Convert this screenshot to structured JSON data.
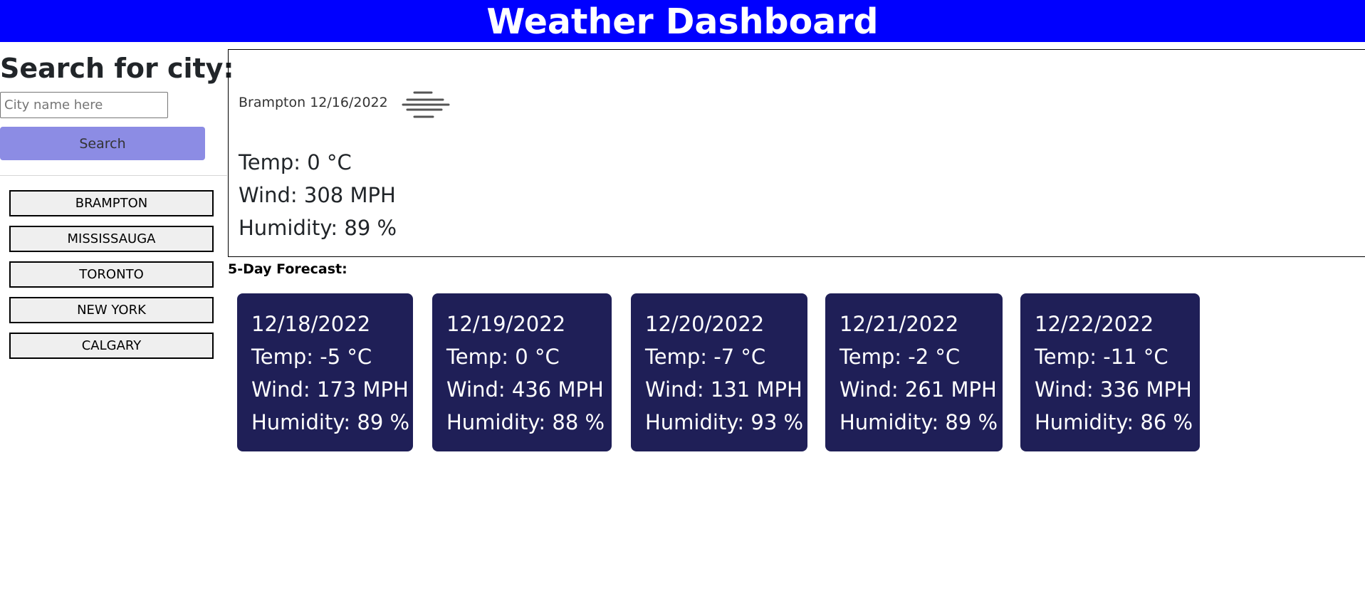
{
  "header": {
    "title": "Weather Dashboard"
  },
  "search": {
    "title": "Search for city:",
    "placeholder": "City name here",
    "value": "",
    "button_label": "Search"
  },
  "history": {
    "items": [
      {
        "label": "BRAMPTON"
      },
      {
        "label": "MISSISSAUGA"
      },
      {
        "label": "TORONTO"
      },
      {
        "label": "NEW YORK"
      },
      {
        "label": "CALGARY"
      }
    ]
  },
  "current": {
    "city_date": "Brampton 12/16/2022",
    "icon": "fog-icon",
    "temp": "Temp: 0 °C",
    "wind": "Wind: 308 MPH",
    "humidity": "Humidity: 89 %"
  },
  "forecast": {
    "title": "5-Day Forecast:",
    "days": [
      {
        "date": "12/18/2022",
        "temp": "Temp: -5 °C",
        "wind": "Wind: 173 MPH",
        "humidity": "Humidity: 89 %"
      },
      {
        "date": "12/19/2022",
        "temp": "Temp: 0 °C",
        "wind": "Wind: 436 MPH",
        "humidity": "Humidity: 88 %"
      },
      {
        "date": "12/20/2022",
        "temp": "Temp: -7 °C",
        "wind": "Wind: 131 MPH",
        "humidity": "Humidity: 93 %"
      },
      {
        "date": "12/21/2022",
        "temp": "Temp: -2 °C",
        "wind": "Wind: 261 MPH",
        "humidity": "Humidity: 89 %"
      },
      {
        "date": "12/22/2022",
        "temp": "Temp: -11 °C",
        "wind": "Wind: 336 MPH",
        "humidity": "Humidity: 86 %"
      }
    ]
  },
  "colors": {
    "header_bg": "#0000ff",
    "search_button": "#8c8ce4",
    "forecast_card_bg": "#1f1f57"
  }
}
